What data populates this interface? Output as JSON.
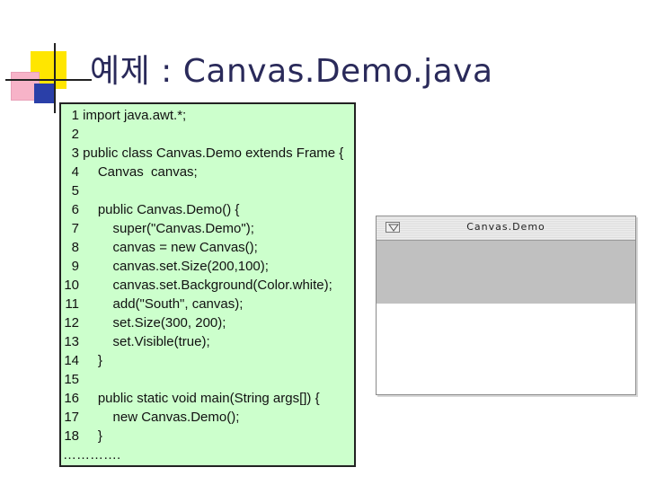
{
  "slide": {
    "title": "예제 : Canvas.Demo.java"
  },
  "code": {
    "lines": [
      {
        "num": "1",
        "text": " import java.awt.*;"
      },
      {
        "num": "2",
        "text": ""
      },
      {
        "num": "3",
        "text": " public class Canvas.Demo extends Frame {"
      },
      {
        "num": "4",
        "text": "     Canvas  canvas;"
      },
      {
        "num": "5",
        "text": ""
      },
      {
        "num": "6",
        "text": "     public Canvas.Demo() {"
      },
      {
        "num": "7",
        "text": "         super(\"Canvas.Demo\");"
      },
      {
        "num": "8",
        "text": "         canvas = new Canvas();"
      },
      {
        "num": "9",
        "text": "         canvas.set.Size(200,100);"
      },
      {
        "num": "10",
        "text": "         canvas.set.Background(Color.white);"
      },
      {
        "num": "11",
        "text": "         add(\"South\", canvas);"
      },
      {
        "num": "12",
        "text": "         set.Size(300, 200);"
      },
      {
        "num": "13",
        "text": "         set.Visible(true);"
      },
      {
        "num": "14",
        "text": "     }"
      },
      {
        "num": "15",
        "text": ""
      },
      {
        "num": "16",
        "text": "     public static void main(String args[]) {"
      },
      {
        "num": "17",
        "text": "         new Canvas.Demo();"
      },
      {
        "num": "18",
        "text": "     }"
      }
    ],
    "ellipsis": "…………."
  },
  "window": {
    "title": "Canvas.Demo",
    "menu_icon": "window-menu-icon",
    "frame_color": "#c0c0c0",
    "canvas_color": "#ffffff"
  },
  "colors": {
    "code_background": "#ccffcc",
    "title_text": "#2a2a5a",
    "accent_yellow": "#ffe600",
    "accent_blue": "#2a3fa8",
    "accent_pink": "#f7b3c8"
  }
}
